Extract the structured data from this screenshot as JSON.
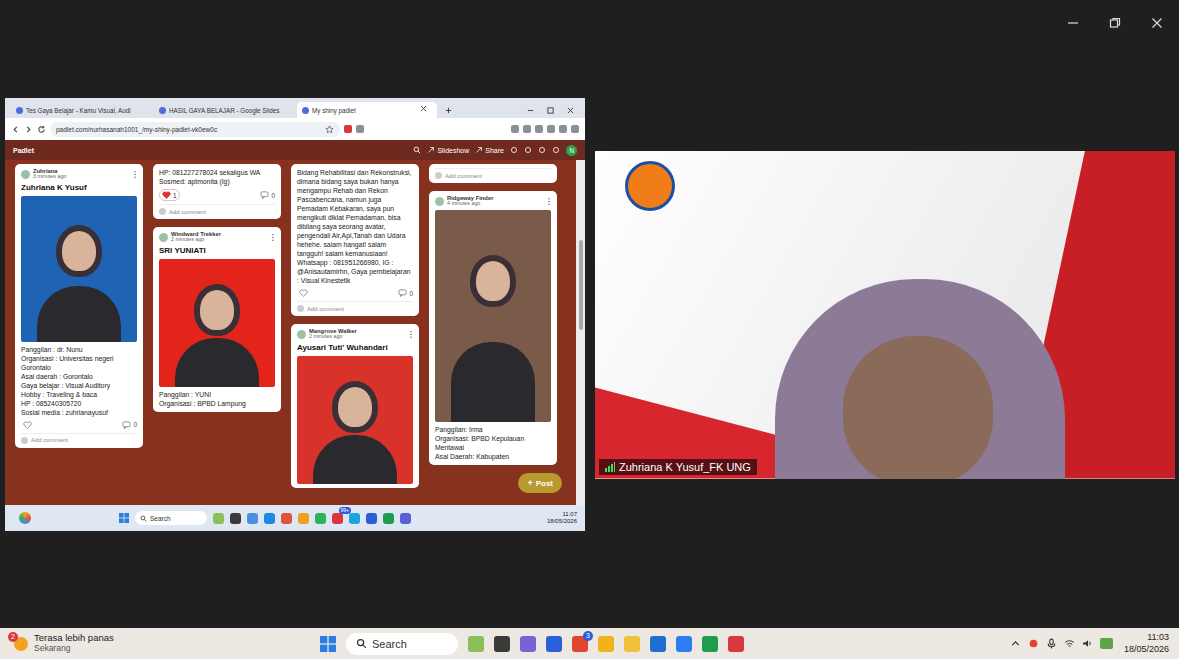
{
  "shared_screen": {
    "browser": {
      "tabs": [
        {
          "label": "Tes Gaya Belajar - Kamu Visual, Audi",
          "selected": false
        },
        {
          "label": "HASIL GAYA BELAJAR - Google Slides",
          "selected": false
        },
        {
          "label": "My shiny padlet",
          "selected": true
        }
      ],
      "address": "padlet.com/nurhasanah1001_/my-shiny-padlet-vk0ew0c"
    },
    "padlet": {
      "brand": "Padlet",
      "actions": [
        "Slideshow",
        "Share"
      ],
      "avatar": "N",
      "columns": [
        {
          "cards": [
            {
              "author": "Zuhriana",
              "time": "3 minutes ago",
              "title": "Zuhriana K Yusuf",
              "color": "#1f63b5",
              "lines": [
                "Panggilan : dr. Nunu",
                "Organisasi : Universitas negeri Gorontalo",
                "Asal daerah : Gorontalo",
                "Gaya belajar : Visual Auditory",
                "Hobby : Traveling & baca",
                "HP : 085240305720",
                "Sosial media : zuhrianayusuf"
              ],
              "liked": false,
              "comments": "0",
              "add_comment": "Add comment"
            }
          ]
        },
        {
          "cards": [
            {
              "lines": [
                "HP: 081227278024 sekaligus WA",
                "Sosmed: aptmonita (Ig)"
              ],
              "liked": true,
              "likes": "1",
              "comments": "0",
              "add_comment": "Add comment"
            },
            {
              "author": "Windward Trekker",
              "time": "2 minutes ago",
              "title": "SRI YUNIATI",
              "color": "#e3241b",
              "lines": [
                "Panggilan : YUNI",
                "Organisasi : BPBD Lampung"
              ]
            }
          ]
        },
        {
          "cards": [
            {
              "lines": [
                "Bidang Rehabilitasi dan Rekonstruksi, dimana bidang saya bukan hanya mengampu Rehab dan Rekon Pascabencana, namun juga Pemadam Kebakaran, saya pun mengikuti diklat Pemadaman, bisa dibilang saya seorang avatar, pengendali Air,Api,Tanah dan Udara hehehe. salam hangat! salam tangguh! salam kemanusiaan! Whatsapp : 081951266980, IG : @Anisautamirhn, Gaya pembelajaran : Visual Kinestetik"
              ],
              "liked": false,
              "comments": "0",
              "add_comment": "Add comment"
            },
            {
              "author": "Mangrove Walker",
              "time": "2 minutes ago",
              "title": "Ayusari Tuti' Wuhandari",
              "color": "#d8322a"
            }
          ]
        },
        {
          "cards": [
            {
              "add_comment": "Add comment"
            },
            {
              "author": "Ridgeway Finder",
              "time": "4 minutes ago",
              "color": "#7a5a48",
              "lines": [
                "Panggilan: Irma",
                "Organisasi: BPBD Kepulauan Mentawai",
                "Asal Daerah: Kabupaten"
              ]
            }
          ]
        }
      ],
      "post_button": {
        "icon": "+",
        "label": "Post"
      }
    },
    "taskbar": {
      "search": "Search",
      "badge": "99+",
      "time": "11:07",
      "date": "18/05/2026"
    }
  },
  "video_tile": {
    "name": "Zuhriana K Yusuf_FK UNG"
  },
  "taskbar": {
    "weather": {
      "badge": "2",
      "title": "Terasa lebih panas",
      "subtitle": "Sekarang"
    },
    "search": "Search",
    "app_badge": "3",
    "time": "11:03",
    "date": "18/05/2026"
  }
}
